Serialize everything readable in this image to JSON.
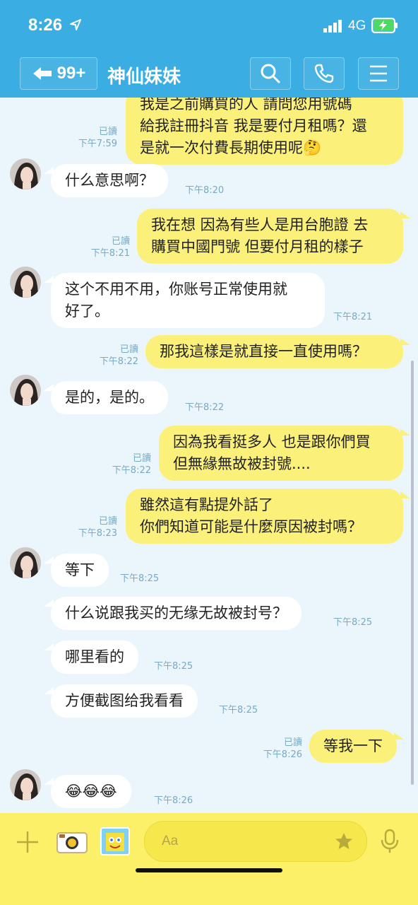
{
  "status_bar": {
    "time": "8:26",
    "network": "4G"
  },
  "header": {
    "back_count": "99+",
    "title": "神仙妹妹"
  },
  "messages": [
    {
      "dir": "out",
      "lines": [
        "我是之前購買的人 請問您用號碼",
        "給我註冊抖音 我是要付月租嗎？還",
        "是就一次付費長期使用呢🤔"
      ],
      "read": "已讀",
      "time": "下午7:59"
    },
    {
      "dir": "in",
      "lines": [
        "什么意思啊？"
      ],
      "time": "下午8:20"
    },
    {
      "dir": "out",
      "lines": [
        "我在想 因為有些人是用台胞證 去",
        "購買中國門號 但要付月租的樣子"
      ],
      "read": "已讀",
      "time": "下午8:21"
    },
    {
      "dir": "in",
      "lines": [
        "这个不用不用，你账号正常使用就",
        "好了。"
      ],
      "time": "下午8:21"
    },
    {
      "dir": "out",
      "lines": [
        "那我這樣是就直接一直使用嗎？"
      ],
      "read": "已讀",
      "time": "下午8:22"
    },
    {
      "dir": "in",
      "lines": [
        "是的，是的。"
      ],
      "time": "下午8:22"
    },
    {
      "dir": "out",
      "lines": [
        "因為我看挺多人 也是跟你們買",
        "但無緣無故被封號...."
      ],
      "read": "已讀",
      "time": "下午8:22"
    },
    {
      "dir": "out",
      "lines": [
        "雖然這有點提外話了",
        " 你們知道可能是什麼原因被封嗎？"
      ],
      "read": "已讀",
      "time": "下午8:23"
    },
    {
      "dir": "in",
      "lines": [
        "等下"
      ],
      "time": "下午8:25"
    },
    {
      "dir": "in",
      "lines": [
        "什么说跟我买的无缘无故被封号？"
      ],
      "time": "下午8:25"
    },
    {
      "dir": "in",
      "lines": [
        "哪里看的"
      ],
      "time": "下午8:25"
    },
    {
      "dir": "in",
      "lines": [
        "方便截图给我看看"
      ],
      "time": "下午8:25"
    },
    {
      "dir": "out",
      "lines": [
        "等我一下"
      ],
      "read": "已讀",
      "time": "下午8:26"
    },
    {
      "dir": "in",
      "lines": [
        "😂😂😂"
      ],
      "time": "下午8:26"
    }
  ],
  "input": {
    "placeholder": "Aa"
  },
  "icons": [
    "location-arrow-icon",
    "signal-icon",
    "battery-charging-icon",
    "back-arrow-icon",
    "search-icon",
    "phone-icon",
    "menu-icon",
    "plus-icon",
    "camera-icon",
    "sticker-icon",
    "star-icon",
    "microphone-icon"
  ],
  "colors": {
    "header": "#3aaee2",
    "chat_bg": "#eaf6fb",
    "outgoing_bubble": "#fbf17a",
    "incoming_bubble": "#ffffff",
    "input_bar": "#fbf068"
  }
}
